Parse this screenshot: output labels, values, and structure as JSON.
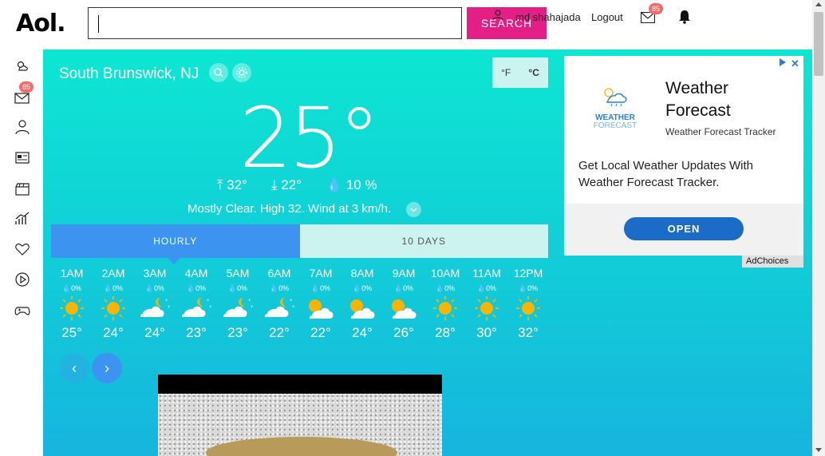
{
  "header": {
    "logo": "Aol.",
    "search_placeholder": "",
    "search_button": "SEARCH",
    "username": "md shahajada",
    "logout": "Logout",
    "mail_badge": "85",
    "icons": [
      "user-icon",
      "mail-icon",
      "bell-icon",
      "apps-grid-icon"
    ]
  },
  "sidebar": {
    "items": [
      {
        "icon": "weather-icon"
      },
      {
        "icon": "mail-icon",
        "badge": "85"
      },
      {
        "icon": "user-icon"
      },
      {
        "icon": "news-icon"
      },
      {
        "icon": "entertainment-icon"
      },
      {
        "icon": "finance-icon"
      },
      {
        "icon": "lifestyle-icon"
      },
      {
        "icon": "video-icon"
      },
      {
        "icon": "games-icon"
      }
    ]
  },
  "weather": {
    "location": "South Brunswick, NJ",
    "unit_f": "°F",
    "unit_c": "°C",
    "current_temp": "25°",
    "high": "32°",
    "low": "22°",
    "precip": "10 %",
    "description": "Mostly Clear. High 32. Wind at 3 km/h.",
    "tabs": {
      "hourly": "HOURLY",
      "ten_days": "10 DAYS"
    },
    "hourly": [
      {
        "time": "1AM",
        "precip": "0%",
        "icon": "sun",
        "temp": "25°"
      },
      {
        "time": "2AM",
        "precip": "0%",
        "icon": "sun",
        "temp": "24°"
      },
      {
        "time": "3AM",
        "precip": "0%",
        "icon": "cloud-moon",
        "temp": "24°"
      },
      {
        "time": "4AM",
        "precip": "0%",
        "icon": "cloud-moon",
        "temp": "23°"
      },
      {
        "time": "5AM",
        "precip": "0%",
        "icon": "cloud-moon",
        "temp": "23°"
      },
      {
        "time": "6AM",
        "precip": "0%",
        "icon": "cloud-moon",
        "temp": "22°"
      },
      {
        "time": "7AM",
        "precip": "0%",
        "icon": "cloud-sun",
        "temp": "22°"
      },
      {
        "time": "8AM",
        "precip": "0%",
        "icon": "cloud-sun",
        "temp": "24°"
      },
      {
        "time": "9AM",
        "precip": "0%",
        "icon": "cloud-sun",
        "temp": "26°"
      },
      {
        "time": "10AM",
        "precip": "0%",
        "icon": "sun",
        "temp": "28°"
      },
      {
        "time": "11AM",
        "precip": "0%",
        "icon": "sun",
        "temp": "30°"
      },
      {
        "time": "12PM",
        "precip": "0%",
        "icon": "sun",
        "temp": "32°"
      }
    ]
  },
  "ad": {
    "logo_line1": "WEATHER",
    "logo_line2": "FORECAST",
    "title": "Weather Forecast",
    "subtitle": "Weather Forecast Tracker",
    "body": "Get Local Weather Updates With Weather Forecast Tracker.",
    "button": "OPEN",
    "adchoices": "AdChoices"
  },
  "colors": {
    "brand_pink": "#e31e85",
    "tab_active": "#3d94f0",
    "ad_button": "#1a6cc6",
    "sun": "#f7b500"
  }
}
